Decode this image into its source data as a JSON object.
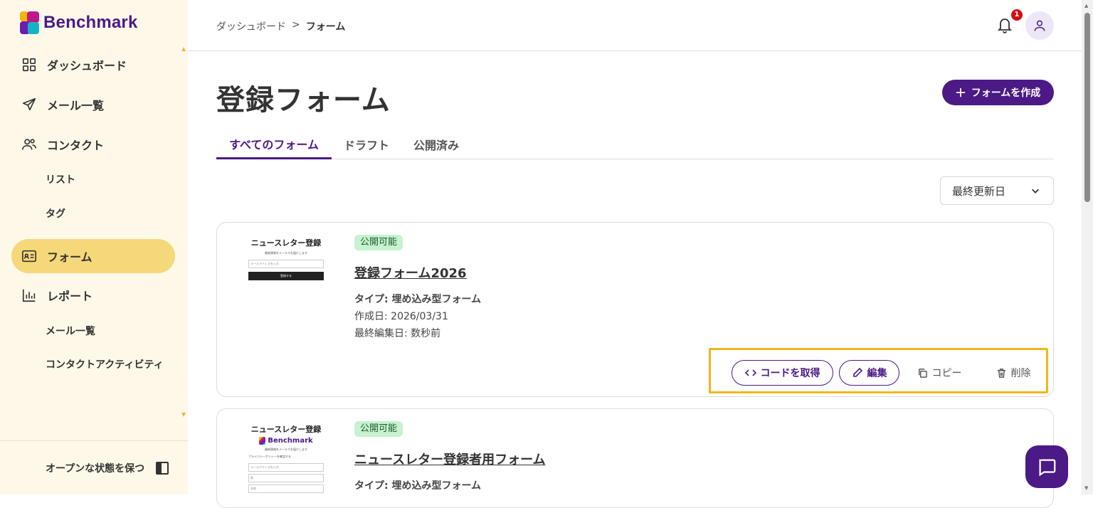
{
  "app": {
    "brand": "Benchmark",
    "brand_color": "#4b1a86",
    "accent_color": "#f5d87a"
  },
  "sidebar": {
    "items": [
      {
        "label": "ダッシュボード",
        "icon": "grid-icon"
      },
      {
        "label": "メール一覧",
        "icon": "send-icon"
      },
      {
        "label": "コンタクト",
        "icon": "contacts-icon"
      },
      {
        "label": "リスト"
      },
      {
        "label": "タグ"
      },
      {
        "label": "フォーム",
        "icon": "form-card-icon",
        "active": true
      },
      {
        "label": "レポート",
        "icon": "bar-chart-icon"
      },
      {
        "label": "メール一覧"
      },
      {
        "label": "コンタクトアクティビティ"
      }
    ],
    "footer_label": "オープンな状態を保つ"
  },
  "header": {
    "breadcrumb": {
      "parent": "ダッシュボード",
      "separator": ">",
      "current": "フォーム"
    },
    "notification_count": "1"
  },
  "page": {
    "title": "登録フォーム",
    "create_button": "フォームを作成",
    "tabs": [
      {
        "label": "すべてのフォーム",
        "active": true
      },
      {
        "label": "ドラフト"
      },
      {
        "label": "公開済み"
      }
    ],
    "sort": {
      "selected": "最終更新日"
    }
  },
  "forms": [
    {
      "thumbnail": {
        "title": "ニュースレター登録",
        "subtitle": "最新情報をメールでお届けします",
        "input_placeholder": "メールアドレスを入力",
        "button": "登録する"
      },
      "status": "公開可能",
      "name": "登録フォーム2026",
      "type": "タイプ: 埋め込み型フォーム",
      "created": "作成日: 2026/03/31",
      "edited": "最終編集日: 数秒前",
      "actions": {
        "get_code": "コードを取得",
        "edit": "編集",
        "copy": "コピー",
        "delete": "削除"
      }
    },
    {
      "thumbnail": {
        "title": "ニュースレター登録",
        "brand": "Benchmark",
        "subtitle": "最新情報をメールでお届けします",
        "privacy": "プライバシーポリシーを確認する",
        "fields": [
          "メールアドレスを入力",
          "姓",
          "名前"
        ]
      },
      "status": "公開可能",
      "name": "ニュースレター登録者用フォーム",
      "type": "タイプ: 埋め込み型フォーム"
    }
  ]
}
